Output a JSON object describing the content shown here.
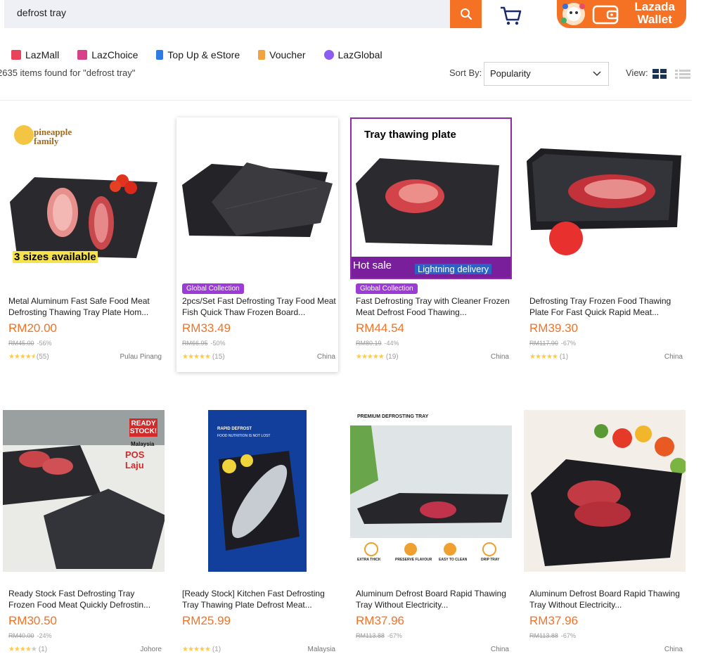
{
  "search": {
    "query": "defrost tray"
  },
  "wallet": {
    "line1": "Lazada",
    "line2": "Wallet"
  },
  "nav": [
    "LazMall",
    "LazChoice",
    "Top Up & eStore",
    "Voucher",
    "LazGlobal"
  ],
  "results": {
    "found_text": "2635 items found for \"defrost tray\"",
    "sort_label": "Sort By:",
    "sort_value": "Popularity",
    "view_label": "View:"
  },
  "colors": {
    "accent": "#f57224",
    "badge": "#9b3cd6",
    "star": "#faca51"
  },
  "products": [
    {
      "title": "Metal Aluminum Fast Safe Food Meat Defrosting Thawing Tray Plate Hom...",
      "price": "RM20.00",
      "orig": "RM45.00",
      "discount": "-56%",
      "rating": 4.5,
      "reviews": "(55)",
      "location": "Pulau Pinang",
      "badge": "",
      "img_label": "3 sizes available",
      "brand": "pineapple family"
    },
    {
      "title": "2pcs/Set Fast Defrosting Tray Food Meat Fish Quick Thaw Frozen Board...",
      "price": "RM33.49",
      "orig": "RM66.95",
      "discount": "-50%",
      "rating": 5,
      "reviews": "(15)",
      "location": "China",
      "badge": "Global Collection"
    },
    {
      "title": "Fast Defrosting Tray with Cleaner Frozen Meat Defrost Food Thawing...",
      "price": "RM44.54",
      "orig": "RM80.19",
      "discount": "-44%",
      "rating": 5,
      "reviews": "(19)",
      "location": "China",
      "badge": "Global Collection",
      "img_title": "Tray thawing plate",
      "img_hot": "Hot sale",
      "img_lightning": "Lightning delivery"
    },
    {
      "title": "Defrosting Tray Frozen Food Thawing Plate For Fast Quick Rapid Meat...",
      "price": "RM39.30",
      "orig": "RM117.90",
      "discount": "-67%",
      "rating": 5,
      "reviews": "(1)",
      "location": "China",
      "badge": ""
    },
    {
      "title": "Ready Stock Fast Defrosting Tray Frozen Food Meat Quickly Defrostin...",
      "price": "RM30.50",
      "orig": "RM40.00",
      "discount": "-24%",
      "rating": 4,
      "reviews": "(1)",
      "location": "Johore",
      "badge": "",
      "img_ready": "READY STOCK!",
      "img_malaysia": "Malaysia",
      "img_pos": "POS Laju"
    },
    {
      "title": "[Ready Stock] Kitchen Fast Defrosting Tray Thawing Plate Defrost Meat...",
      "price": "RM25.99",
      "orig": "",
      "discount": "",
      "rating": 5,
      "reviews": "(1)",
      "location": "Malaysia",
      "badge": "",
      "img_line1": "RAPID DEFROST",
      "img_line2": "FOOD NUTRITION IS NOT LOST"
    },
    {
      "title": "Aluminum Defrost Board Rapid Thawing Tray Without Electricity...",
      "price": "RM37.96",
      "orig": "RM113.88",
      "discount": "-67%",
      "rating": 0,
      "reviews": "",
      "location": "China",
      "badge": "",
      "img_title": "PREMIUM DEFROSTING TRAY",
      "features": [
        "EXTRA THICK",
        "PRESERVE FLAVOUR",
        "EASY TO CLEAN",
        "DRIP TRAY"
      ]
    },
    {
      "title": "Aluminum Defrost Board Rapid Thawing Tray Without Electricity...",
      "price": "RM37.96",
      "orig": "RM113.88",
      "discount": "-67%",
      "rating": 0,
      "reviews": "",
      "location": "China",
      "badge": ""
    }
  ]
}
